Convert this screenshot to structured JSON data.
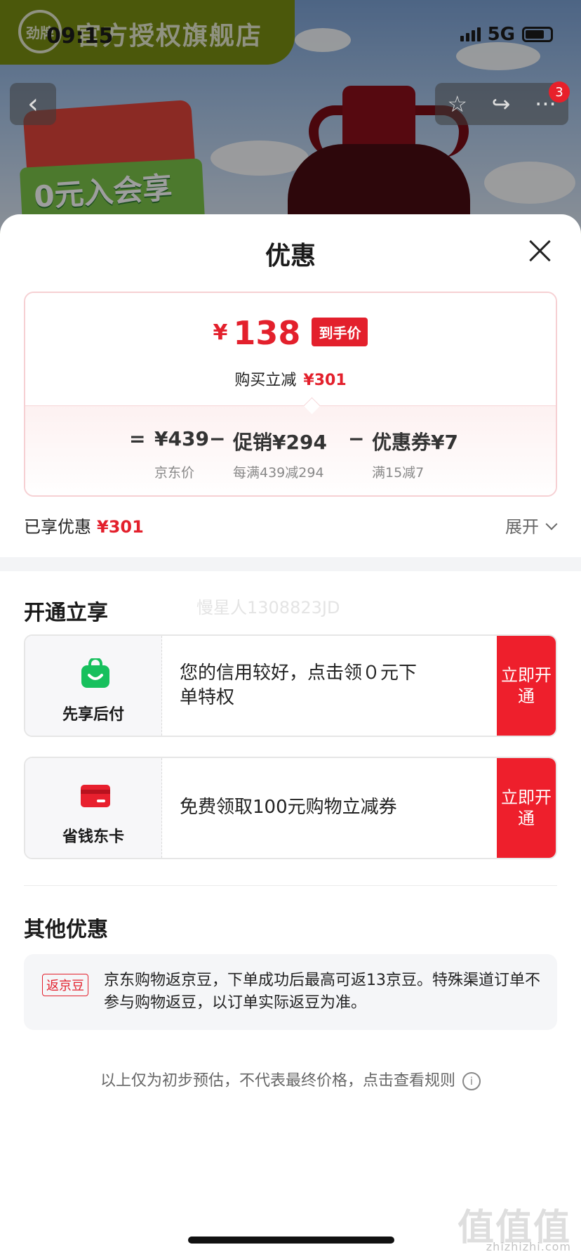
{
  "status_bar": {
    "time": "09:15",
    "network": "5G"
  },
  "background": {
    "shop_logo_text": "劲牌",
    "shop_name": "官方授权旗舰店",
    "promo_text": "0元入会享",
    "cart_badge": "3"
  },
  "sheet": {
    "title": "优惠",
    "final_price": {
      "symbol": "¥",
      "amount": "138",
      "tag": "到手价"
    },
    "discount_line": {
      "label": "购买立减",
      "amount": "¥301"
    },
    "breakdown": {
      "equals": "=",
      "jd_price": {
        "value": "¥439",
        "label": "京东价"
      },
      "minus1": "−",
      "promo": {
        "value": "促销¥294",
        "label": "每满439减294"
      },
      "minus2": "−",
      "coupon": {
        "value": "优惠券¥7",
        "label": "满15减7"
      }
    },
    "enjoyed": {
      "label": "已享优惠",
      "amount": "¥301"
    },
    "expand_label": "展开"
  },
  "open_section": {
    "title": "开通立享",
    "watermark": "慢星人1308823JD",
    "offers": [
      {
        "name": "先享后付",
        "text": "您的信用较好，点击领０元下单特权",
        "button": "立即开通",
        "icon": "bag-icon",
        "color": "#17c05d"
      },
      {
        "name": "省钱东卡",
        "text": "免费领取100元购物立减券",
        "button": "立即开通",
        "icon": "card-icon",
        "color": "#e8202e"
      }
    ]
  },
  "other_section": {
    "title": "其他优惠",
    "tag": "返京豆",
    "text": "京东购物返京豆，下单成功后最高可返13京豆。特殊渠道订单不参与购物返豆，以订单实际返豆为准。"
  },
  "footer": {
    "note": "以上仅为初步预估，不代表最终价格，点击查看规则",
    "info_glyph": "i"
  },
  "watermark_site": {
    "mark": "值值值",
    "url": "zhizhizhi.com"
  },
  "colors": {
    "accent": "#e3202c",
    "button": "#ee1f2c",
    "shop_banner": "#7a8f12"
  }
}
